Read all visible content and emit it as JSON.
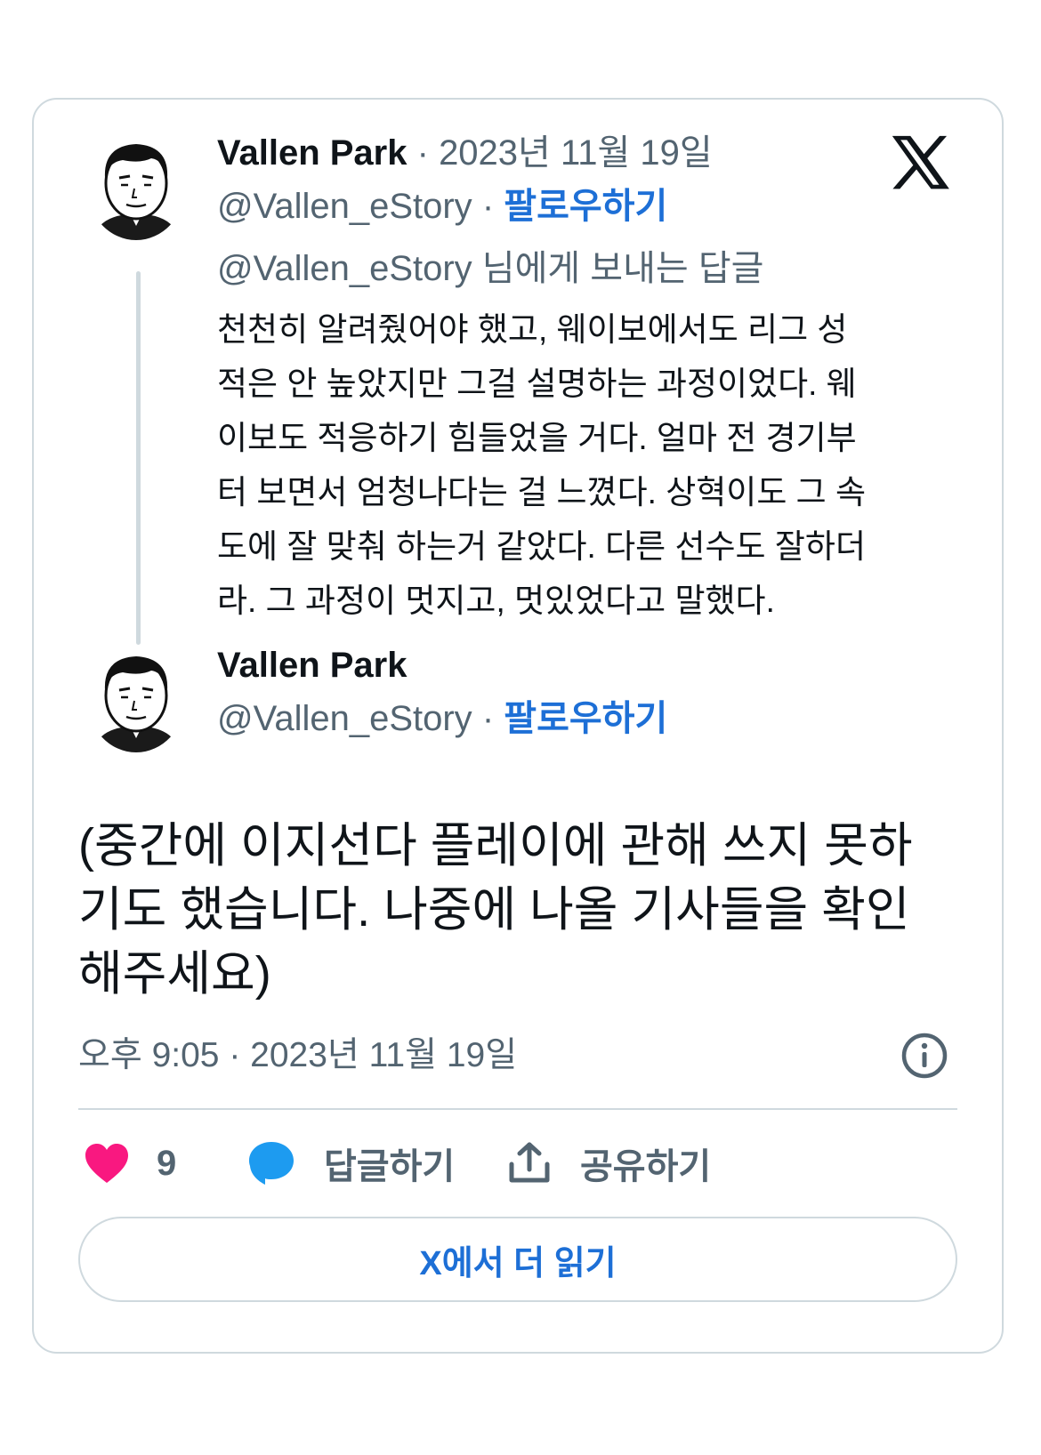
{
  "reply_tweet": {
    "author_name": "Vallen Park",
    "separator": "·",
    "date": "2023년 11월 19일",
    "handle": "@Vallen_eStory",
    "follow_label": "팔로우하기",
    "reply_to": "@Vallen_eStory 님에게 보내는 답글",
    "text_lines": [
      "천천히 알려줬어야 했고, 웨이보에서도 리그 성",
      "적은 안 높았지만 그걸 설명하는 과정이었다. 웨",
      "이보도 적응하기 힘들었을 거다. 얼마 전 경기부",
      "터 보면서 엄청나다는 걸 느꼈다. 상혁이도 그 속",
      "도에 잘 맞춰 하는거 같았다. 다른 선수도 잘하더",
      "라. 그 과정이 멋지고, 멋있었다고 말했다."
    ]
  },
  "main_tweet": {
    "author_name": "Vallen Park",
    "handle": "@Vallen_eStory",
    "separator": "·",
    "follow_label": "팔로우하기",
    "text_lines": [
      "(중간에 이지선다 플레이에 관해 쓰지 못하",
      "기도 했습니다. 나중에 나올 기사들을 확인",
      "해주세요)"
    ],
    "timestamp": "오후 9:05 · 2023년 11월 19일"
  },
  "actions": {
    "like_count": "9",
    "reply_label": "답글하기",
    "share_label": "공유하기"
  },
  "read_more_label": "X에서 더 읽기",
  "colors": {
    "accent": "#1d6fd6",
    "like": "#f91880",
    "reply": "#1d9bf0",
    "muted": "#536471",
    "border": "#cfd9de"
  },
  "icons": [
    "x-logo-icon",
    "info-icon",
    "heart-icon",
    "reply-bubble-icon",
    "share-icon"
  ]
}
